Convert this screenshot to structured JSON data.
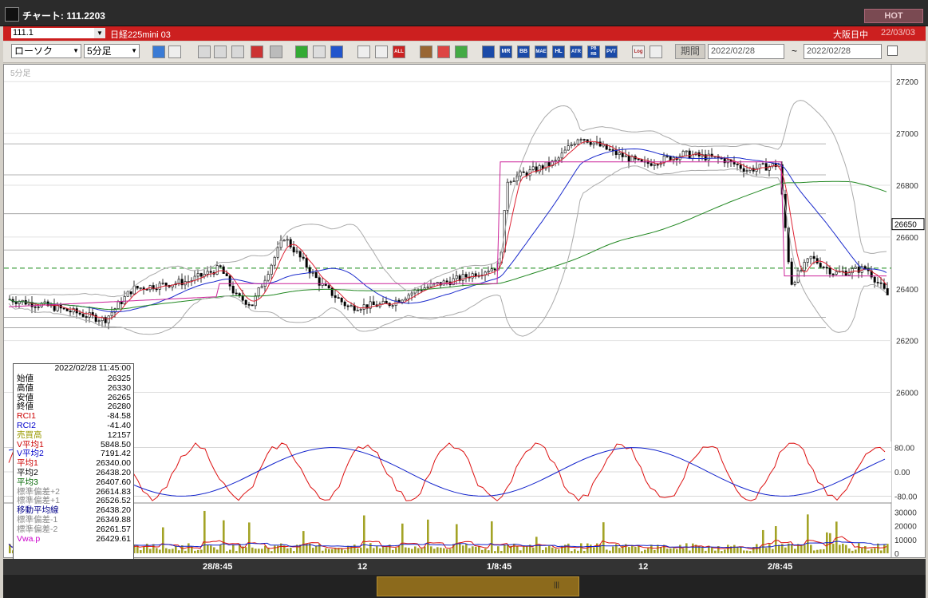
{
  "window": {
    "title": "チャート: 111.2203",
    "hot_label": "HOT"
  },
  "infobar": {
    "code": "111.1",
    "instrument": "日経225mini 03",
    "session": "大阪日中",
    "date": "22/03/03"
  },
  "toolbar": {
    "chart_type": "ローソク",
    "interval": "5分足",
    "buttons": [
      "MR",
      "BB",
      "MAE",
      "HL",
      "ATR",
      "PB RB",
      "PVT",
      "Log"
    ],
    "period_label": "期間",
    "date_from": "2022/02/28",
    "date_to": "2022/02/28"
  },
  "chart": {
    "interval_label": "5分足",
    "current_price": "26650",
    "y_ticks": [
      "27200",
      "27000",
      "26800",
      "26600",
      "26400",
      "26200",
      "26000"
    ],
    "osc_ticks": [
      "80.00",
      "0.00",
      "-80.00"
    ],
    "vol_ticks": [
      "30000",
      "20000",
      "10000",
      "0"
    ],
    "x_labels": [
      "28/8:45",
      "12",
      "1/8:45",
      "12",
      "2/8:45"
    ]
  },
  "chart_data": {
    "type": "candlestick",
    "y_range": [
      25900,
      27250
    ],
    "candle_series": [
      {
        "label": "28/8:45",
        "open": 26330,
        "high": 26400,
        "low": 26250,
        "close": 26350
      },
      {
        "label": "12",
        "open": 26380,
        "high": 26640,
        "low": 26280,
        "close": 26420
      },
      {
        "label": "1/8:45",
        "open": 26600,
        "high": 27010,
        "low": 26580,
        "close": 26950
      },
      {
        "label": "12",
        "open": 26930,
        "high": 26950,
        "low": 26850,
        "close": 26880
      },
      {
        "label": "2/8:45",
        "open": 26450,
        "high": 26580,
        "low": 26350,
        "close": 26360
      }
    ],
    "osc_range": [
      -100,
      100
    ],
    "vol_range": [
      0,
      35000
    ]
  },
  "panel": {
    "datetime": "2022/02/28 11:45:00",
    "rows": [
      {
        "k": "始値",
        "v": "26325",
        "color": "#000000"
      },
      {
        "k": "高値",
        "v": "26330",
        "color": "#000000"
      },
      {
        "k": "安値",
        "v": "26265",
        "color": "#000000"
      },
      {
        "k": "終値",
        "v": "26280",
        "color": "#000000"
      },
      {
        "k": "RCI1",
        "v": "-84.58",
        "color": "#cc0000"
      },
      {
        "k": "RCI2",
        "v": "-41.40",
        "color": "#0000cc"
      },
      {
        "k": "売買高",
        "v": "12157",
        "color": "#999900"
      },
      {
        "k": "V平均1",
        "v": "5848.50",
        "color": "#cc0000"
      },
      {
        "k": "V平均2",
        "v": "7191.42",
        "color": "#0000cc"
      },
      {
        "k": "平均1",
        "v": "26340.00",
        "color": "#cc0000"
      },
      {
        "k": "平均2",
        "v": "26438.20",
        "color": "#000000"
      },
      {
        "k": "平均3",
        "v": "26407.60",
        "color": "#006600"
      },
      {
        "k": "標準偏差+2",
        "v": "26614.83",
        "color": "#888888"
      },
      {
        "k": "標準偏差+1",
        "v": "26526.52",
        "color": "#888888"
      },
      {
        "k": "移動平均線",
        "v": "26438.20",
        "color": "#000088"
      },
      {
        "k": "標準偏差-1",
        "v": "26349.88",
        "color": "#888888"
      },
      {
        "k": "標準偏差-2",
        "v": "26261.57",
        "color": "#888888"
      },
      {
        "k": "Vwa.p",
        "v": "26429.61",
        "color": "#cc00cc"
      }
    ]
  }
}
